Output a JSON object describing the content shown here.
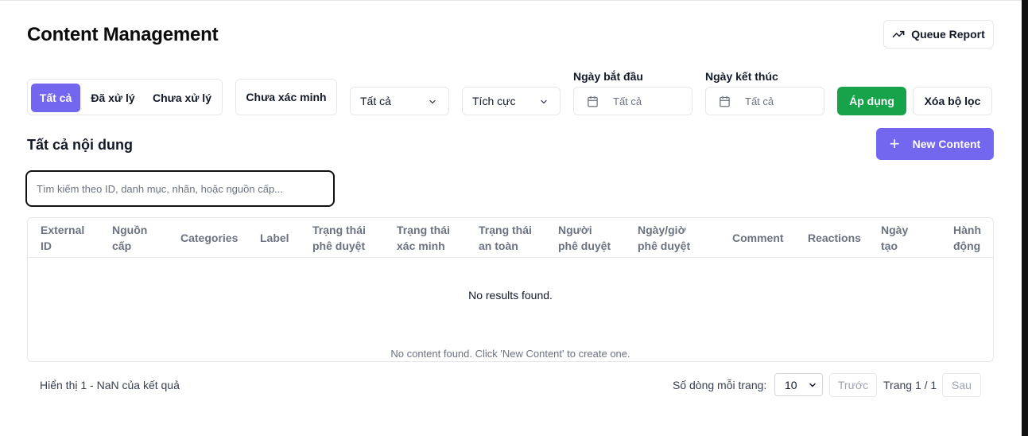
{
  "page": {
    "title": "Content Management"
  },
  "header": {
    "queue_report_label": "Queue Report",
    "queue_icon": "trending-up-icon"
  },
  "filters": {
    "status_tabs": [
      {
        "label": "Tất cả",
        "active": true
      },
      {
        "label": "Đã xử lý",
        "active": false
      },
      {
        "label": "Chưa xử lý",
        "active": false
      }
    ],
    "unverified_label": "Chưa xác minh",
    "select_all": {
      "value": "Tất cả"
    },
    "select_sentiment": {
      "value": "Tích cực"
    },
    "start_date": {
      "label": "Ngày bắt đầu",
      "placeholder": "Tất cả"
    },
    "end_date": {
      "label": "Ngày kết thúc",
      "placeholder": "Tất cả"
    },
    "apply_label": "Áp dụng",
    "clear_label": "Xóa bộ lọc"
  },
  "content": {
    "section_title": "Tất cả nội dung",
    "new_button_label": "New Content",
    "search_placeholder": "Tìm kiếm theo ID, danh mục, nhãn, hoặc nguồn cấp...",
    "columns": [
      {
        "line1": "External",
        "line2": "ID"
      },
      {
        "line1": "Nguồn",
        "line2": "cấp"
      },
      {
        "line1": "Categories",
        "line2": ""
      },
      {
        "line1": "Label",
        "line2": ""
      },
      {
        "line1": "Trạng thái",
        "line2": "phê duyệt"
      },
      {
        "line1": "Trạng thái",
        "line2": "xác minh"
      },
      {
        "line1": "Trạng thái",
        "line2": "an toàn"
      },
      {
        "line1": "Người",
        "line2": "phê duyệt"
      },
      {
        "line1": "Ngày/giờ",
        "line2": "phê duyệt"
      },
      {
        "line1": "Comment",
        "line2": ""
      },
      {
        "line1": "Reactions",
        "line2": ""
      },
      {
        "line1": "Ngày",
        "line2": "tạo"
      },
      {
        "line1": "Hành",
        "line2": "động"
      }
    ],
    "empty_text": "No results found.",
    "caption": "No content found. Click 'New Content' to create one."
  },
  "pagination": {
    "info": "Hiển thị 1 - NaN của kết quả",
    "rows_label": "Số dòng mỗi trang:",
    "rows_value": "10",
    "prev_label": "Trước",
    "page_indicator": "Trang 1 / 1",
    "next_label": "Sau"
  },
  "colors": {
    "accent": "#7367f0",
    "success": "#16a34a",
    "border": "#e5e7eb",
    "muted_text": "#6b7280"
  }
}
